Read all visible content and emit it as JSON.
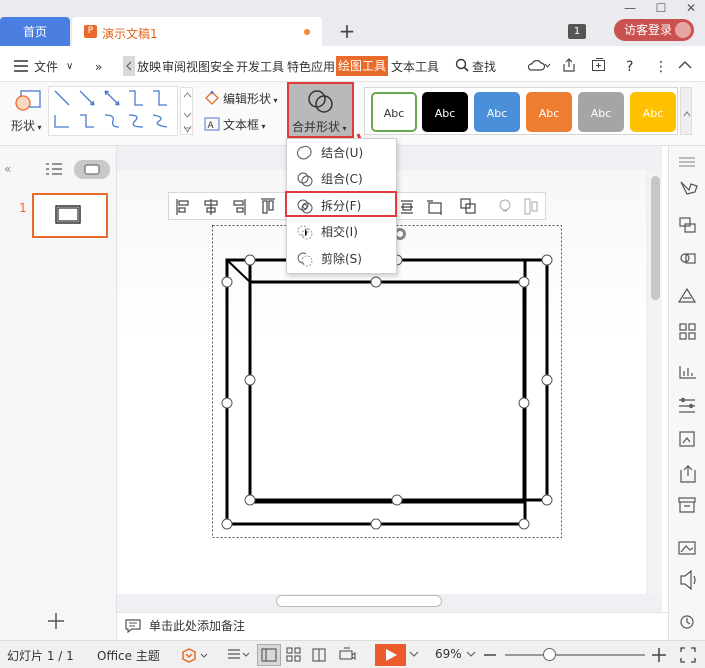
{
  "titlebar": {
    "home_tab": "首页",
    "doc_tab": "演示文稿1",
    "new_tab": "+",
    "page_badge": "1",
    "visitor_login": "访客登录"
  },
  "menu": {
    "file": "文件",
    "more": "»",
    "tabs": [
      "放映",
      "审阅",
      "视图",
      "安全",
      "开发工具",
      "特色应用",
      "绘图工具",
      "文本工具"
    ],
    "search": "查找"
  },
  "toolbar": {
    "shape_label": "形状",
    "edit_shape": "编辑形状",
    "text_box": "文本框",
    "merge_shape": "合并形状",
    "styles": [
      {
        "label": "Abc",
        "bg": "#ffffff",
        "fg": "#333333",
        "border": "#6aa84f"
      },
      {
        "label": "Abc",
        "bg": "#000000",
        "fg": "#ffffff",
        "border": "#000000"
      },
      {
        "label": "Abc",
        "bg": "#4a90d9",
        "fg": "#ffffff",
        "border": "#4a90d9"
      },
      {
        "label": "Abc",
        "bg": "#ed7d31",
        "fg": "#ffffff",
        "border": "#ed7d31"
      },
      {
        "label": "Abc",
        "bg": "#a5a5a5",
        "fg": "#ffffff",
        "border": "#a5a5a5"
      },
      {
        "label": "Abc",
        "bg": "#ffc000",
        "fg": "#ffffff",
        "border": "#ffc000"
      }
    ]
  },
  "merge_menu": {
    "union": "结合(U)",
    "combine": "组合(C)",
    "split": "拆分(F)",
    "intersect": "相交(I)",
    "subtract": "剪除(S)"
  },
  "slides": {
    "number": "1"
  },
  "notes": {
    "placeholder": "单击此处添加备注"
  },
  "status": {
    "slide_count": "幻灯片 1 / 1",
    "theme": "Office 主题",
    "zoom": "69%"
  },
  "colors": {
    "accent": "#e96b2c",
    "home_tab": "#4a7fe1",
    "highlight": "#e23b3b",
    "login": "#c95150"
  }
}
